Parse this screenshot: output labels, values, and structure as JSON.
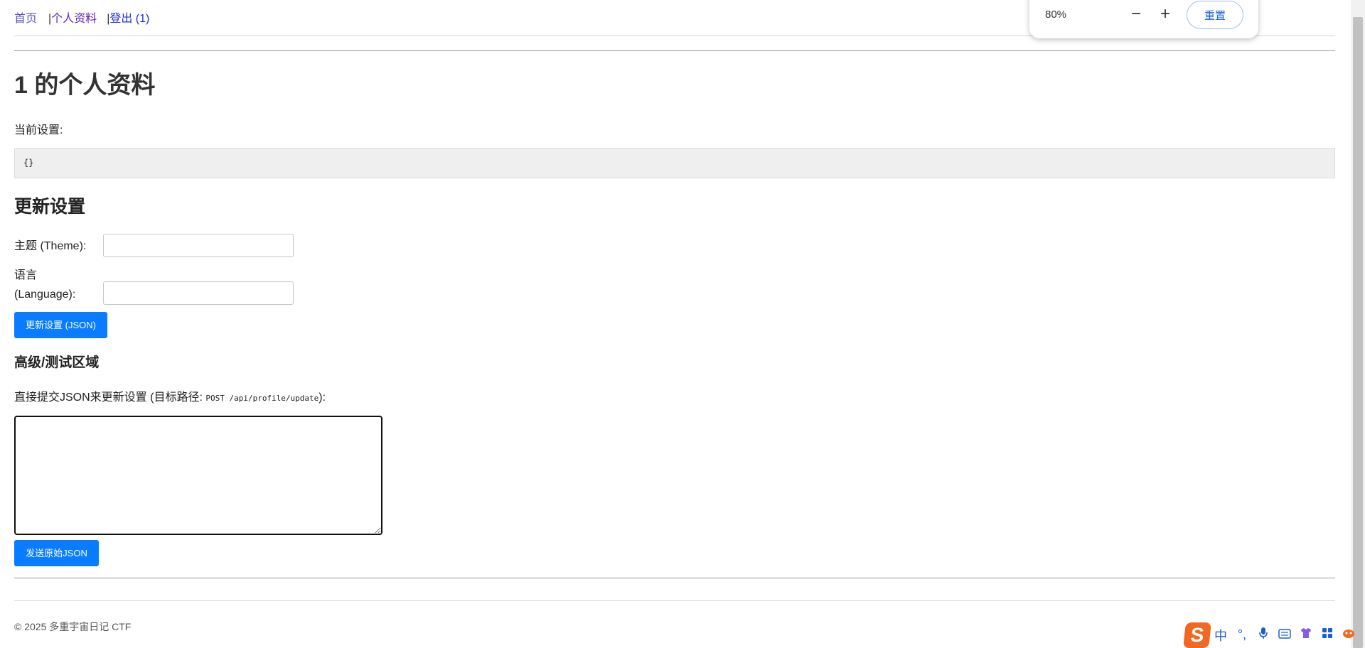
{
  "nav": {
    "home": "首页",
    "sep1": "|",
    "profile": "个人资料",
    "sep2": "|",
    "logout": "登出 (1)"
  },
  "page_title": "1 的个人资料",
  "current_settings_label": "当前设置:",
  "current_settings_value": "{}",
  "update_heading": "更新设置",
  "form": {
    "theme_label": "主题 (Theme):",
    "theme_value": "",
    "language_label": "语言 (Language):",
    "language_value": "",
    "update_button": "更新设置 (JSON)"
  },
  "advanced_heading": "高级/测试区域",
  "direct_text_before": "直接提交JSON来更新设置 (目标路径: ",
  "direct_path": "POST /api/profile/update",
  "direct_text_after": "):",
  "raw_json_value": "",
  "send_button": "发送原始JSON",
  "footer": "© 2025 多重宇宙日记 CTF",
  "zoom_popup": {
    "level": "80%",
    "minus": "−",
    "plus": "+",
    "reset": "重置"
  },
  "ime": {
    "logo": "S",
    "mode": "中",
    "punct": "°,",
    "icons": [
      "sogou-logo-icon",
      "chinese-mode-icon",
      "punctuation-icon",
      "microphone-icon",
      "keyboard-icon",
      "skin-icon",
      "toolbox-icon",
      "mascot-icon"
    ]
  },
  "colors": {
    "primary_button": "#0a7cff",
    "nav_link": "#5a1fb8",
    "code_bg": "#efefef"
  }
}
